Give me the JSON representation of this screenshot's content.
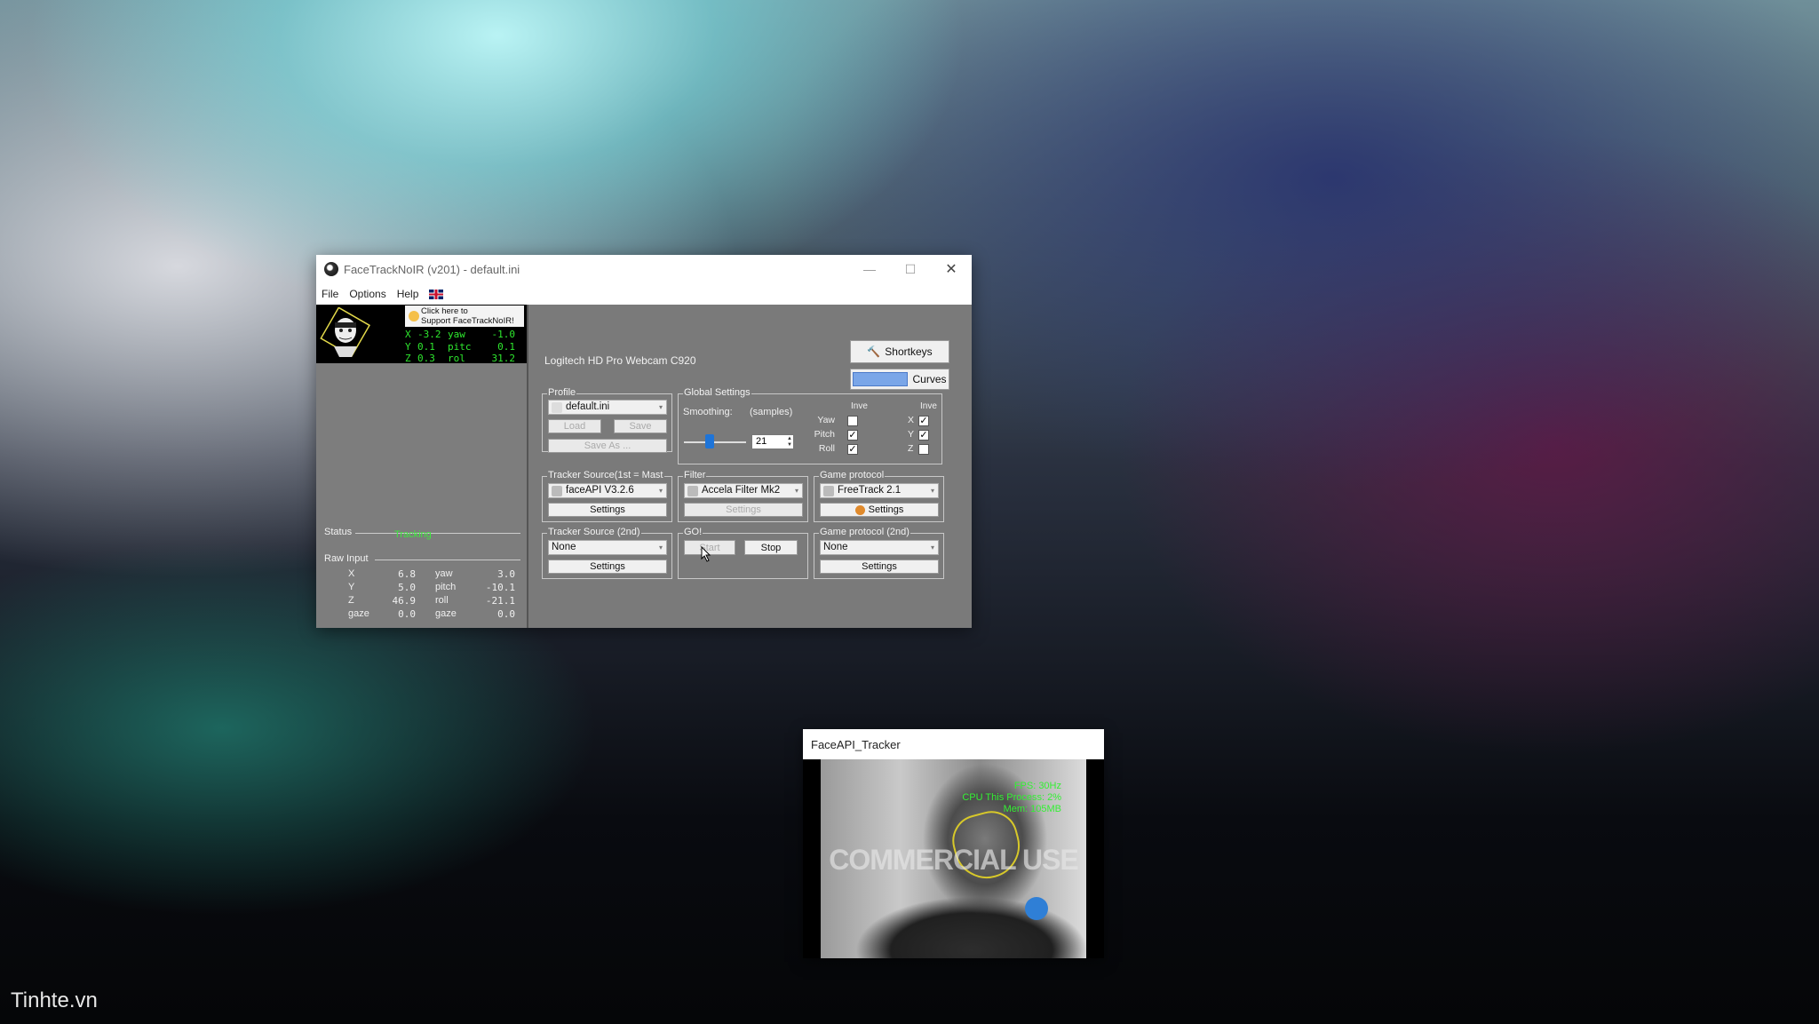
{
  "watermark": "Tinhte.vn",
  "main_window": {
    "title": "FaceTrackNoIR (v201) - default.ini",
    "controls": {
      "minimize": "—",
      "maximize": "☐",
      "close": "✕"
    },
    "menu": [
      "File",
      "Options",
      "Help"
    ]
  },
  "hud": {
    "support_line1": "Click here to",
    "support_line2": "Support FaceTrackNoIR!",
    "rows": [
      {
        "axis": "X",
        "value": "-3.2",
        "angle": "yaw",
        "angle_value": "-1.0"
      },
      {
        "axis": "Y",
        "value": "0.1",
        "angle": "pitc",
        "angle_value": "0.1"
      },
      {
        "axis": "Z",
        "value": "0.3",
        "angle": "rol",
        "angle_value": "31.2"
      }
    ]
  },
  "status": {
    "label": "Status",
    "value": "Tracking"
  },
  "raw_input": {
    "label": "Raw Input",
    "rows": [
      {
        "a": "X",
        "av": "6.8",
        "b": "yaw",
        "bv": "3.0"
      },
      {
        "a": "Y",
        "av": "5.0",
        "b": "pitch",
        "bv": "-10.1"
      },
      {
        "a": "Z",
        "av": "46.9",
        "b": "roll",
        "bv": "-21.1"
      },
      {
        "a": "gaze",
        "av": "0.0",
        "b": "gaze",
        "bv": "0.0"
      }
    ]
  },
  "camera_name": "Logitech HD Pro Webcam C920",
  "shortkeys_label": "Shortkeys",
  "curves_label": "Curves",
  "profile": {
    "title": "Profile",
    "selected": "default.ini",
    "load": "Load",
    "save": "Save",
    "save_as": "Save As ..."
  },
  "global_settings": {
    "title": "Global Settings",
    "smoothing": "Smoothing:",
    "samples": "(samples)",
    "smoothing_value": "21",
    "slider_fraction": 0.4,
    "invert_header_1": "Inve",
    "invert_header_2": "Inve",
    "rotations": [
      {
        "label": "Yaw",
        "checked": false
      },
      {
        "label": "Pitch",
        "checked": true
      },
      {
        "label": "Roll",
        "checked": true
      }
    ],
    "translations": [
      {
        "label": "X",
        "checked": true
      },
      {
        "label": "Y",
        "checked": true
      },
      {
        "label": "Z",
        "checked": false
      }
    ]
  },
  "tracker_source": {
    "title": "Tracker Source(1st = Mast",
    "selected": "faceAPI V3.2.6",
    "settings": "Settings"
  },
  "filter": {
    "title": "Filter",
    "selected": "Accela Filter Mk2",
    "settings": "Settings"
  },
  "game_protocol": {
    "title": "Game protocol",
    "selected": "FreeTrack 2.1",
    "settings": "Settings"
  },
  "tracker_source_2": {
    "title": "Tracker Source (2nd)",
    "selected": "None",
    "settings": "Settings"
  },
  "go": {
    "title": "GO!",
    "start": "Start",
    "stop": "Stop"
  },
  "game_protocol_2": {
    "title": "Game protocol (2nd)",
    "selected": "None",
    "settings": "Settings"
  },
  "tracker_window": {
    "title": "FaceAPI_Tracker",
    "fps": "FPS: 30Hz",
    "cpu": "CPU This Process: 2%",
    "mem": "Mem: 105MB",
    "overlay": "COMMERCIAL USE"
  },
  "colors": {
    "tracking_green": "#3ee83e",
    "accent_blue": "#1e74d8"
  }
}
